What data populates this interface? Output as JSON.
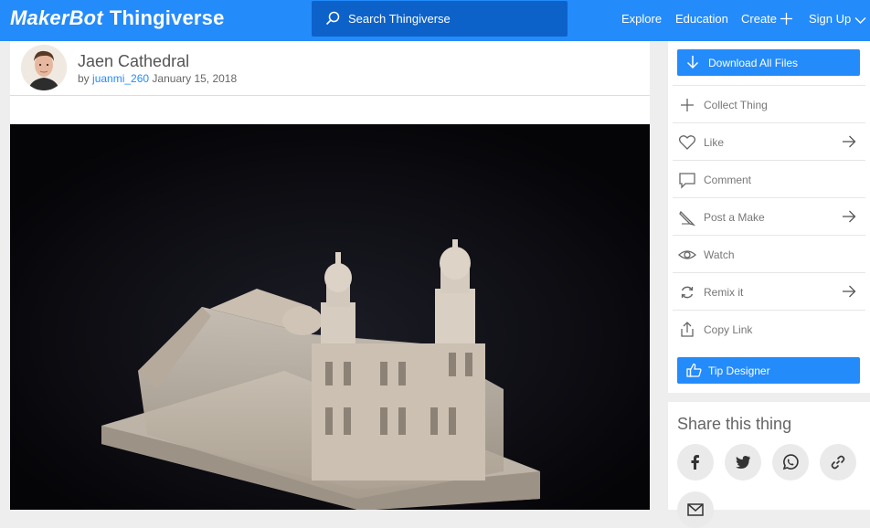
{
  "topbar": {
    "logo_brand": "MakerBot",
    "logo_product": "Thingiverse",
    "search_placeholder": "Search Thingiverse",
    "nav": {
      "explore": "Explore",
      "education": "Education",
      "create": "Create",
      "signup": "Sign Up"
    },
    "bg_color": "#248bfb",
    "search_bg_color": "#0d62c9"
  },
  "thing": {
    "title": "Jaen Cathedral",
    "by": "by",
    "author": "juanmi_260",
    "date": "January 15, 2018",
    "author_color": "#248bfb"
  },
  "actions": {
    "download_all": "Download All Files",
    "collect": "Collect Thing",
    "like": "Like",
    "comment": "Comment",
    "post_make": "Post a Make",
    "watch": "Watch",
    "remix": "Remix it",
    "copy_link": "Copy Link",
    "tip": "Tip Designer"
  },
  "share": {
    "heading": "Share this thing",
    "icons": [
      "facebook-icon",
      "twitter-icon",
      "whatsapp-icon",
      "link-icon",
      "email-icon"
    ]
  }
}
